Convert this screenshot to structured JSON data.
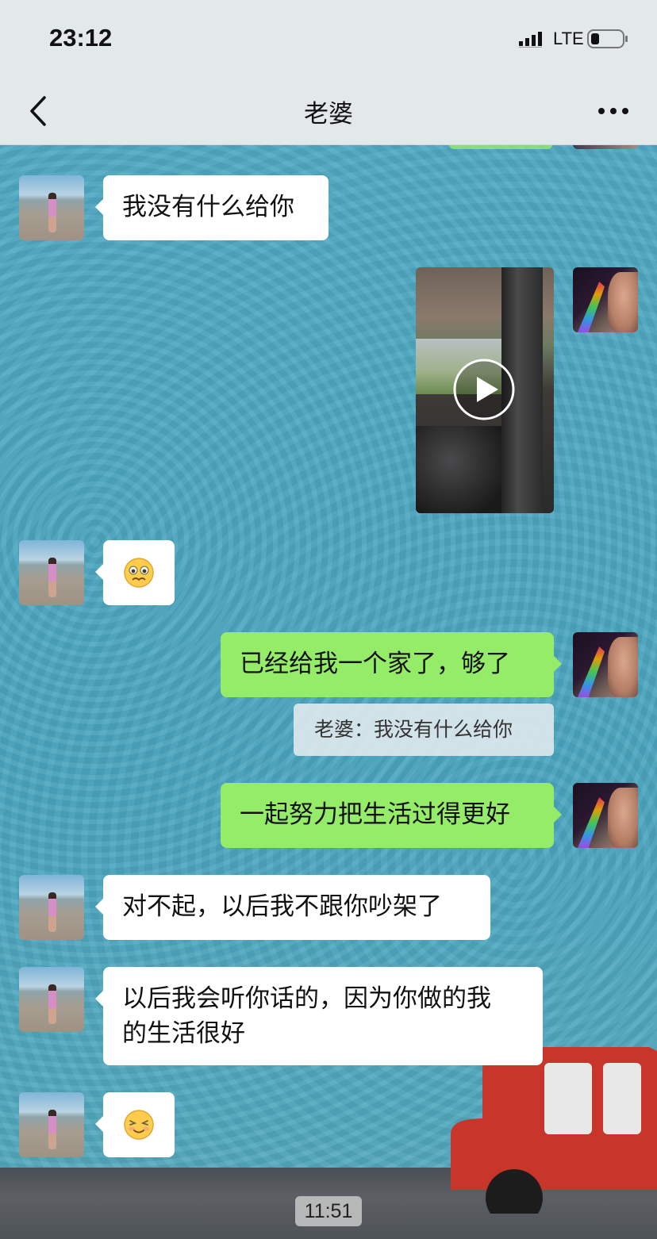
{
  "status_bar": {
    "time": "23:12",
    "network": "LTE"
  },
  "header": {
    "title": "老婆",
    "back_icon": "chevron-left-icon",
    "more_icon": "more-dots-icon"
  },
  "messages": [
    {
      "side": "left",
      "type": "text",
      "text": "我没有什么给你"
    },
    {
      "side": "right",
      "type": "video"
    },
    {
      "side": "left",
      "type": "emoji",
      "emoji": "pleading-face-icon"
    },
    {
      "side": "right",
      "type": "text",
      "text": "已经给我一个家了，够了",
      "quote": "老婆：我没有什么给你"
    },
    {
      "side": "right",
      "type": "text",
      "text": "一起努力把生活过得更好"
    },
    {
      "side": "left",
      "type": "text",
      "text": "对不起，以后我不跟你吵架了"
    },
    {
      "side": "left",
      "type": "text",
      "text_line1": "以后我会听你话的，因为你做的我",
      "text_line2": "的生活很好"
    },
    {
      "side": "left",
      "type": "emoji",
      "emoji": "smiling-face-icon"
    }
  ],
  "footer": {
    "timestamp": "11:51"
  },
  "colors": {
    "header_bg": "#e3e8ea",
    "chat_bg": "#4aa6bf",
    "sent_bubble": "#95ec69",
    "received_bubble": "#ffffff"
  }
}
